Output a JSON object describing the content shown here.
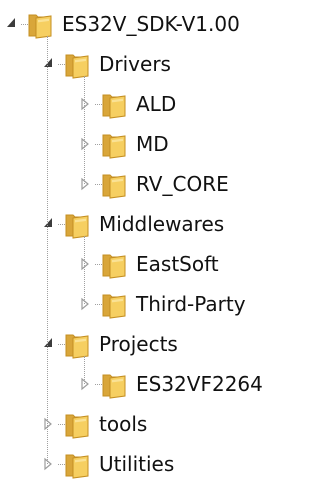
{
  "tree": {
    "nodes": [
      {
        "label": "ES32V_SDK-V1.00",
        "level": 0,
        "state": "expanded"
      },
      {
        "label": "Drivers",
        "level": 1,
        "state": "expanded"
      },
      {
        "label": "ALD",
        "level": 2,
        "state": "collapsed"
      },
      {
        "label": "MD",
        "level": 2,
        "state": "collapsed"
      },
      {
        "label": "RV_CORE",
        "level": 2,
        "state": "collapsed"
      },
      {
        "label": "Middlewares",
        "level": 1,
        "state": "expanded"
      },
      {
        "label": "EastSoft",
        "level": 2,
        "state": "collapsed"
      },
      {
        "label": "Third-Party",
        "level": 2,
        "state": "collapsed"
      },
      {
        "label": "Projects",
        "level": 1,
        "state": "expanded"
      },
      {
        "label": "ES32VF2264",
        "level": 2,
        "state": "collapsed"
      },
      {
        "label": "tools",
        "level": 1,
        "state": "collapsed"
      },
      {
        "label": "Utilities",
        "level": 1,
        "state": "collapsed"
      }
    ]
  },
  "icons": {
    "folder": "folder-icon",
    "expanded": "expanded-triangle-icon",
    "collapsed": "collapsed-triangle-icon"
  },
  "colors": {
    "folder_back": "#d9a63a",
    "folder_front": "#f6cf61",
    "folder_edge": "#c48f22",
    "toggle_expanded": "#3c3c3c",
    "toggle_collapsed": "#9c9c9c"
  }
}
